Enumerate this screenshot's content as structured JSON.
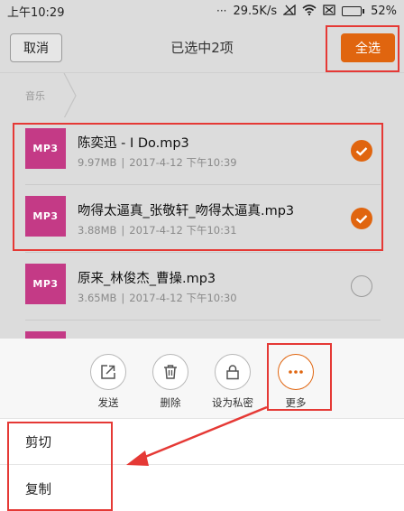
{
  "status_bar": {
    "time": "上午10:29",
    "indicators": "···",
    "net_speed": "29.5K/s",
    "battery": "52%"
  },
  "header": {
    "cancel_label": "取消",
    "title": "已选中2项",
    "select_all_label": "全选"
  },
  "breadcrumb": {
    "label": "音乐"
  },
  "files": [
    {
      "icon_text": "MP3",
      "name": "陈奕迅 - I Do.mp3",
      "size": "9.97MB",
      "date": "2017-4-12 下午10:39",
      "selected": true
    },
    {
      "icon_text": "MP3",
      "name": "吻得太逼真_张敬轩_吻得太逼真.mp3",
      "size": "3.88MB",
      "date": "2017-4-12 下午10:31",
      "selected": true
    },
    {
      "icon_text": "MP3",
      "name": "原来_林俊杰_曹操.mp3",
      "size": "3.65MB",
      "date": "2017-4-12 下午10:30",
      "selected": false
    }
  ],
  "actions": [
    {
      "label": "发送",
      "icon": "share-icon"
    },
    {
      "label": "删除",
      "icon": "trash-icon"
    },
    {
      "label": "设为私密",
      "icon": "lock-icon"
    },
    {
      "label": "更多",
      "icon": "more-icon"
    }
  ],
  "menu": [
    {
      "label": "剪切"
    },
    {
      "label": "复制"
    }
  ],
  "colors": {
    "accent": "#e0650f",
    "mp3_tile": "#c43a86",
    "highlight_box": "#e53935"
  }
}
